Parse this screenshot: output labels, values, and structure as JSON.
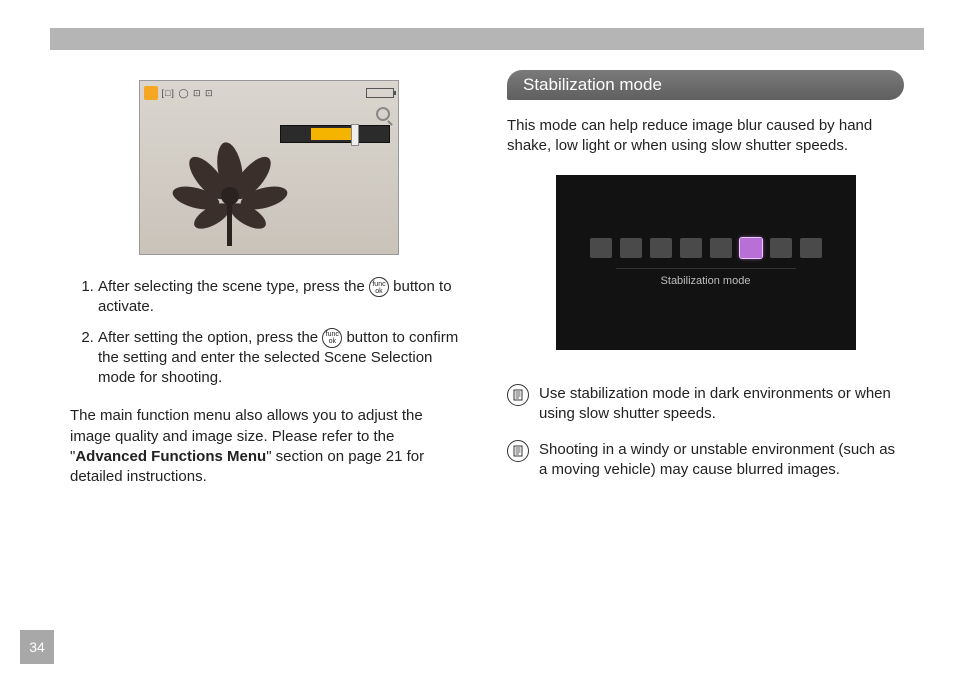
{
  "page_number": "34",
  "left": {
    "steps": [
      {
        "pre": "After selecting the scene type, press the ",
        "post": " button to activate."
      },
      {
        "pre": "After setting the option, press the ",
        "post": " button to confirm the setting and enter the selected Scene Selection mode for shooting."
      }
    ],
    "func_btn_top": "func",
    "func_btn_bottom": "ok",
    "paragraph_pre": "The main function menu also allows you to adjust the image quality and image size. Please refer to the \"",
    "paragraph_bold": "Advanced Functions Menu",
    "paragraph_post": "\" section on page 21 for detailed instructions."
  },
  "right": {
    "heading": "Stabilization mode",
    "intro": "This mode can help reduce image blur caused by hand shake, low light or when using slow shutter speeds.",
    "figure_caption": "Stabilization mode",
    "notes": [
      "Use stabilization mode in dark environments or when using slow shutter speeds.",
      "Shooting in a windy or unstable environment (such as a moving vehicle) may cause blurred images."
    ]
  }
}
